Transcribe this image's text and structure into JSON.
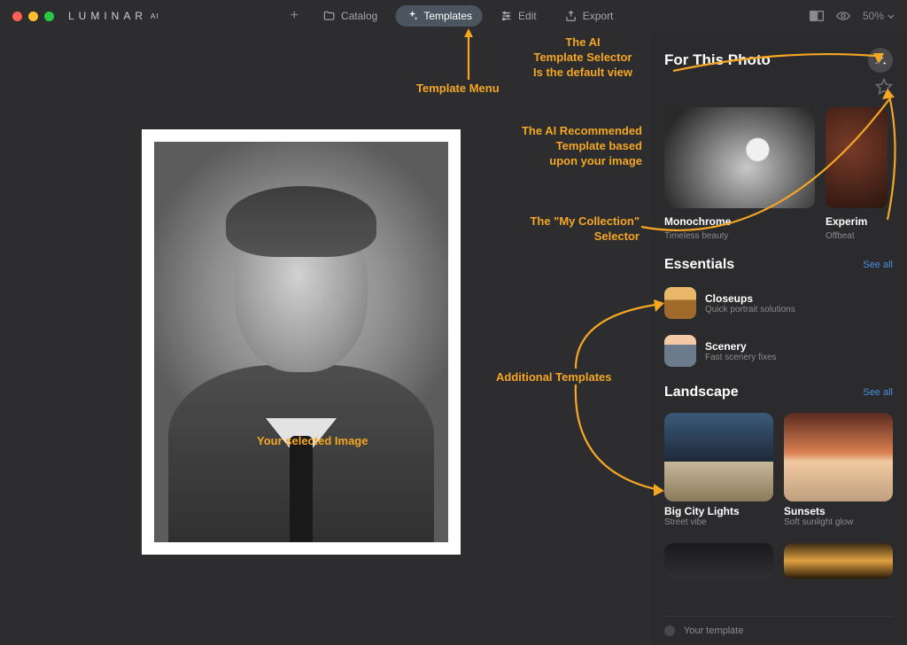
{
  "brand": {
    "name": "LUMINAR",
    "suffix": "AI"
  },
  "nav": {
    "catalog": "Catalog",
    "templates": "Templates",
    "edit": "Edit",
    "export": "Export"
  },
  "zoom": "50%",
  "panel": {
    "for_this_photo": "For This Photo",
    "cards": [
      {
        "name": "Monochrome",
        "sub": "Timeless beauty"
      },
      {
        "name": "Experim",
        "sub": "Offbeat"
      }
    ],
    "essentials": {
      "title": "Essentials",
      "see_all": "See all",
      "items": [
        {
          "name": "Closeups",
          "sub": "Quick portrait solutions"
        },
        {
          "name": "Scenery",
          "sub": "Fast scenery fixes"
        }
      ]
    },
    "landscape": {
      "title": "Landscape",
      "see_all": "See all",
      "items": [
        {
          "name": "Big City Lights",
          "sub": "Street vibe"
        },
        {
          "name": "Sunsets",
          "sub": "Soft sunlight glow"
        }
      ]
    },
    "footer": "Your template"
  },
  "annotations": {
    "template_menu": "Template Menu",
    "ai_selector": "The AI\nTemplate Selector\nIs the default view",
    "ai_recommended": "The AI Recommended\nTemplate based\nupon your image",
    "my_collection": "The \"My Collection\"\nSelector",
    "additional": "Additional Templates",
    "selected_image": "Your selected Image"
  }
}
